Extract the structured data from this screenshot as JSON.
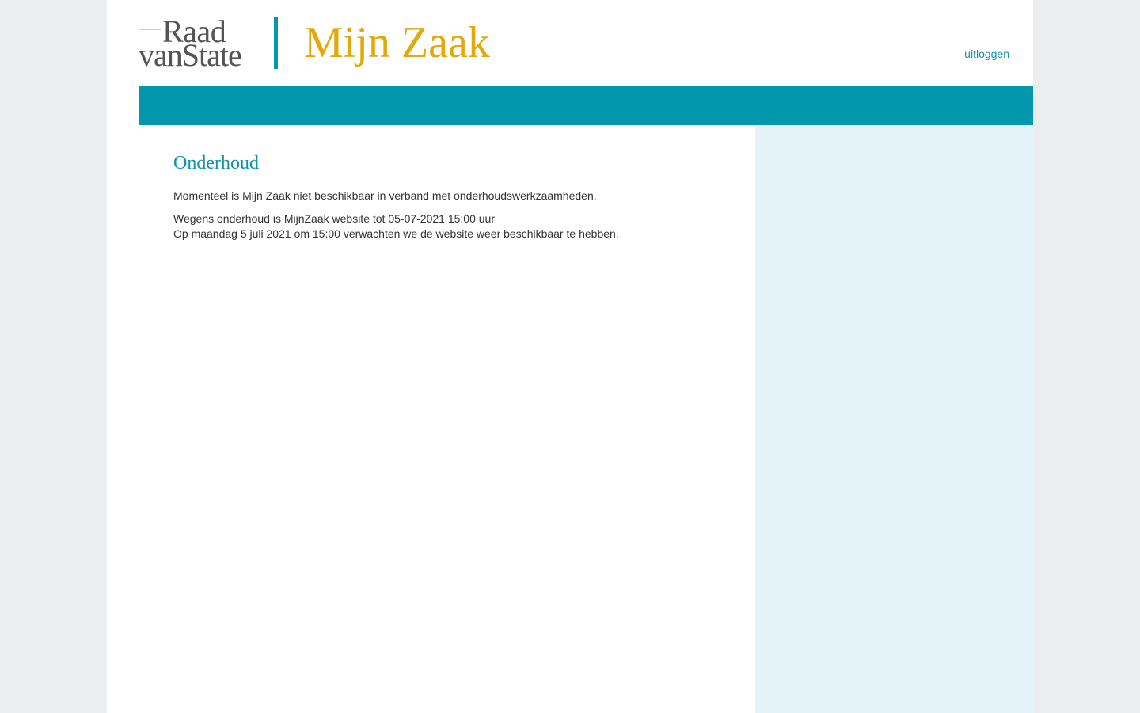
{
  "header": {
    "logo": {
      "line1": "Raad",
      "line2": "vanState"
    },
    "app_title": "Mijn Zaak",
    "logout_label": "uitloggen"
  },
  "main": {
    "heading": "Onderhoud",
    "paragraph1": "Momenteel is Mijn Zaak niet beschikbaar in verband met onderhoudswerkzaamheden.",
    "paragraph2_line1": "Wegens onderhoud is MijnZaak website tot 05-07-2021 15:00 uur",
    "paragraph2_line2": "Op maandag 5 juli 2021 om 15:00 verwachten we de website weer beschikbaar te hebben."
  },
  "colors": {
    "accent_teal": "#0397ad",
    "title_gold": "#e3a80a",
    "sidebar_bg": "#e3f3f8",
    "outer_bg": "#ecedef"
  }
}
